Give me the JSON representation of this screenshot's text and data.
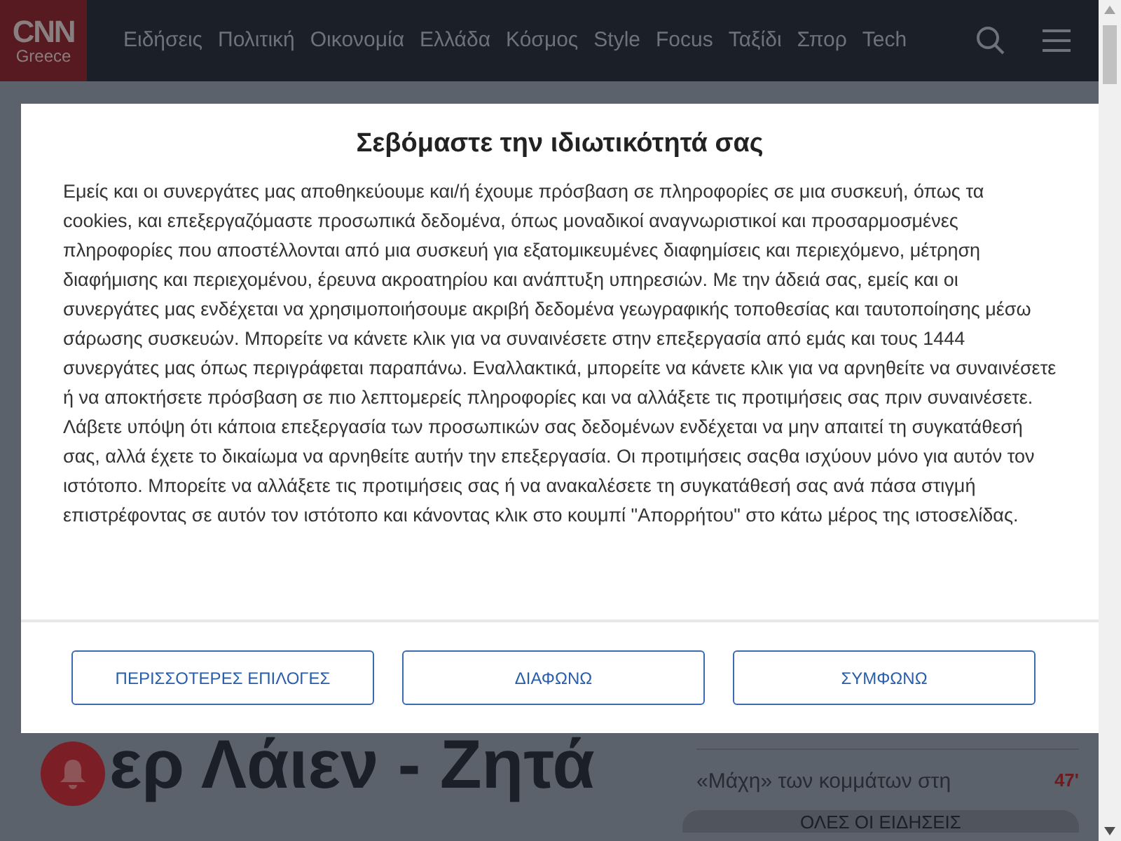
{
  "header": {
    "logo": {
      "top": "CNN",
      "bottom": "Greece"
    },
    "nav": [
      "Ειδήσεις",
      "Πολιτική",
      "Οικονομία",
      "Ελλάδα",
      "Κόσμος",
      "Style",
      "Focus",
      "Ταξίδι",
      "Σπορ",
      "Tech"
    ]
  },
  "article": {
    "headline": "ερ Λάιεν - Ζητά"
  },
  "latest": {
    "items": [
      {
        "title": "«Μάχη» των κομμάτων στη",
        "time": "47'"
      }
    ],
    "all_button": "ΟΛΕΣ ΟΙ ΕΙΔΗΣΕΙΣ"
  },
  "consent_dialog": {
    "title": "Σεβόμαστε την ιδιωτικότητά σας",
    "body": "Εμείς και οι συνεργάτες μας αποθηκεύουμε και/ή έχουμε πρόσβαση σε πληροφορίες σε μια συσκευή, όπως τα cookies, και επεξεργαζόμαστε προσωπικά δεδομένα, όπως μοναδικοί αναγνωριστικοί και προσαρμοσμένες πληροφορίες που αποστέλλονται από μια συσκευή για εξατομικευμένες διαφημίσεις και περιεχόμενο, μέτρηση διαφήμισης και περιεχομένου, έρευνα ακροατηρίου και ανάπτυξη υπηρεσιών. Με την άδειά σας, εμείς και οι συνεργάτες μας ενδέχεται να χρησιμοποιήσουμε ακριβή δεδομένα γεωγραφικής τοποθεσίας και ταυτοποίησης μέσω σάρωσης συσκευών. Μπορείτε να κάνετε κλικ για να συναινέσετε στην επεξεργασία από εμάς και τους 1444 συνεργάτες μας όπως περιγράφεται παραπάνω. Εναλλακτικά, μπορείτε να κάνετε κλικ για να αρνηθείτε να συναινέσετε ή να αποκτήσετε πρόσβαση σε πιο λεπτομερείς πληροφορίες και να αλλάξετε τις προτιμήσεις σας πριν συναινέσετε. Λάβετε υπόψη ότι κάποια επεξεργασία των προσωπικών σας δεδομένων ενδέχεται να μην απαιτεί τη συγκατάθεσή σας, αλλά έχετε το δικαίωμα να αρνηθείτε αυτήν την επεξεργασία. Οι προτιμήσεις σαςθα ισχύουν μόνο για αυτόν τον ιστότοπο. Μπορείτε να αλλάξετε τις προτιμήσεις σας ή να ανακαλέσετε τη συγκατάθεσή σας ανά πάσα στιγμή επιστρέφοντας σε αυτόν τον ιστότοπο και κάνοντας κλικ στο κουμπί \"Απορρήτου\" στο κάτω μέρος της ιστοσελίδας.",
    "buttons": [
      "ΠΕΡΙΣΣΟΤΕΡΕΣ ΕΠΙΛΟΓΕΣ",
      "ΔΙΑΦΩΝΩ",
      "ΣΥΜΦΩΝΩ"
    ]
  }
}
